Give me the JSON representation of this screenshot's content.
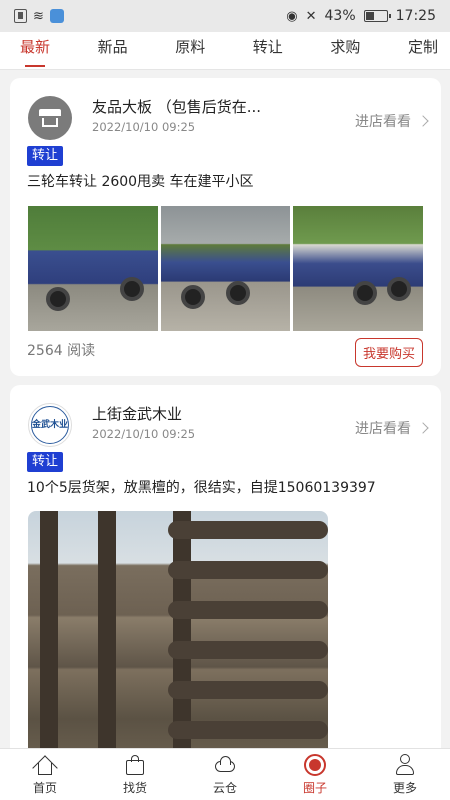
{
  "status_bar": {
    "battery": "43%",
    "time": "17:25"
  },
  "tabs": [
    {
      "label": "最新",
      "active": true
    },
    {
      "label": "新品",
      "active": false
    },
    {
      "label": "原料",
      "active": false
    },
    {
      "label": "转让",
      "active": false
    },
    {
      "label": "求购",
      "active": false
    },
    {
      "label": "定制",
      "active": false
    }
  ],
  "posts": [
    {
      "shop_name": "友品大板 （包售后货在...",
      "time": "2022/10/10 09:25",
      "visit_label": "进店看看",
      "tag": "转让",
      "content": "三轮车转让 2600甩卖 车在建平小区",
      "reads": "2564 阅读",
      "buy_label": "我要购买"
    },
    {
      "shop_name": "上街金武木业",
      "time": "2022/10/10 09:25",
      "visit_label": "进店看看",
      "tag": "转让",
      "content": "10个5层货架，放黑檀的，很结实，自提15060139397",
      "logo_text": "金武木业"
    }
  ],
  "bottom_nav": [
    {
      "label": "首页",
      "icon": "home-icon",
      "active": false
    },
    {
      "label": "找货",
      "icon": "shopping-bag-icon",
      "active": false
    },
    {
      "label": "云仓",
      "icon": "cloud-icon",
      "active": false
    },
    {
      "label": "圈子",
      "icon": "circle-icon",
      "active": true
    },
    {
      "label": "更多",
      "icon": "user-icon",
      "active": false
    }
  ],
  "colors": {
    "accent": "#c8372d",
    "tag_bg": "#1f3fd2"
  }
}
